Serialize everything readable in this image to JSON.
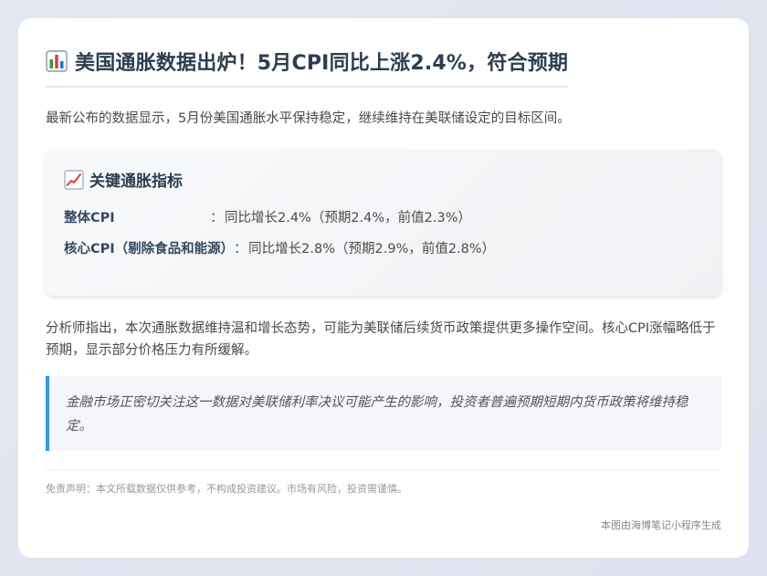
{
  "article": {
    "icon": "bar-chart-icon",
    "title": "美国通胀数据出炉！5月CPI同比上涨2.4%，符合预期",
    "intro": "最新公布的数据显示，5月份美国通胀水平保持稳定，继续维持在美联储设定的目标区间。",
    "metrics": {
      "icon": "trending-up-icon",
      "title": "关键通胀指标",
      "rows": [
        {
          "label": "整体CPI",
          "sep": "：",
          "value": "同比增长2.4%（预期2.4%，前值2.3%）"
        },
        {
          "label": "核心CPI（剔除食品和能源）",
          "sep": "：",
          "value": "同比增长2.8%（预期2.9%，前值2.8%）"
        }
      ]
    },
    "analysis": "分析师指出，本次通胀数据维持温和增长态势，可能为美联储后续货币政策提供更多操作空间。核心CPI涨幅略低于预期，显示部分价格压力有所缓解。",
    "quote": "金融市场正密切关注这一数据对美联储利率决议可能产生的影响，投资者普遍预期短期内货币政策将维持稳定。",
    "disclaimer": "免责声明：本文所载数据仅供参考，不构成投资建议。市场有风险，投资需谨慎。",
    "footer": "本图由海博笔记小程序生成"
  },
  "colors": {
    "accent": "#3498db",
    "heading": "#2c3e50"
  }
}
